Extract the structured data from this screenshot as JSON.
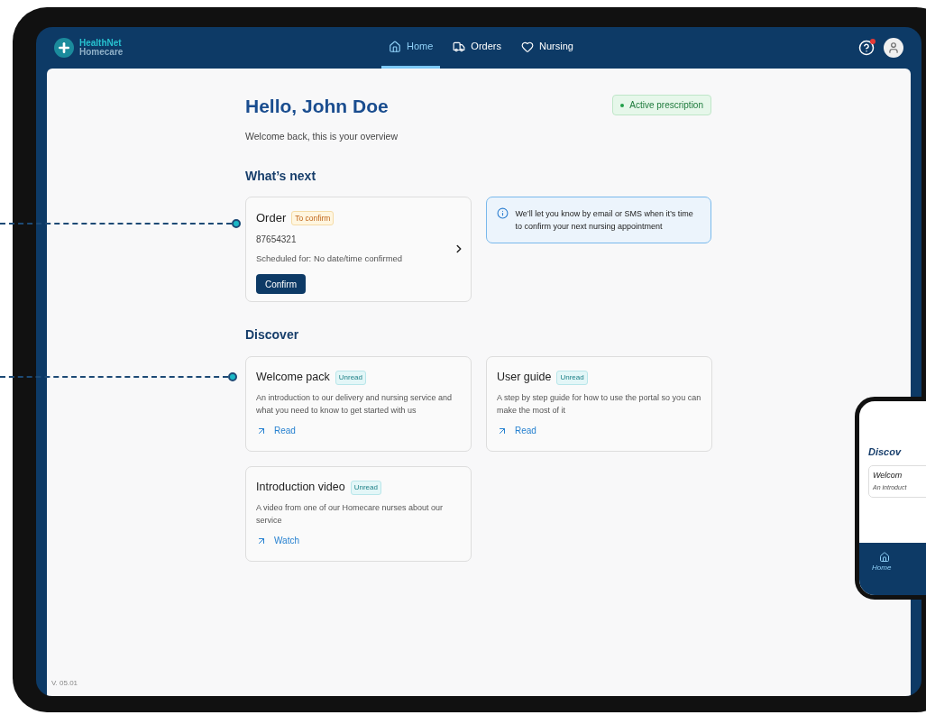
{
  "header": {
    "logo": {
      "line1": "HealthNet",
      "line2": "Homecare"
    },
    "nav": [
      {
        "label": "Home",
        "selected": true
      },
      {
        "label": "Orders",
        "selected": false
      },
      {
        "label": "Nursing",
        "selected": false
      }
    ],
    "help_notification": true
  },
  "greeting": "Hello, John Doe",
  "subtitle": "Welcome back, this is your overview",
  "status_badge": "Active prescription",
  "whats_next": {
    "title": "What’s next",
    "order": {
      "title": "Order",
      "badge": "To confirm",
      "number": "87654321",
      "schedule": "Scheduled for: No date/time confirmed",
      "button": "Confirm"
    },
    "info": "We’ll let you know by email or SMS when it’s time to confirm your next nursing appointment"
  },
  "discover": {
    "title": "Discover",
    "cards": [
      {
        "title": "Welcome pack",
        "badge": "Unread",
        "description": "An introduction to our delivery and nursing service and what you need to know to get started with us",
        "action": "Read"
      },
      {
        "title": "User guide",
        "badge": "Unread",
        "description": "A step by step guide for how to use the portal so you can make the most of it",
        "action": "Read"
      },
      {
        "title": "Introduction video",
        "badge": "Unread",
        "description": "A video from one of our Homecare nurses about our service",
        "action": "Watch"
      }
    ]
  },
  "version": "V. 05.01",
  "phone": {
    "section": "Discov",
    "card_title": "Welcom",
    "card_text": "An introduct",
    "nav_label": "Home"
  }
}
